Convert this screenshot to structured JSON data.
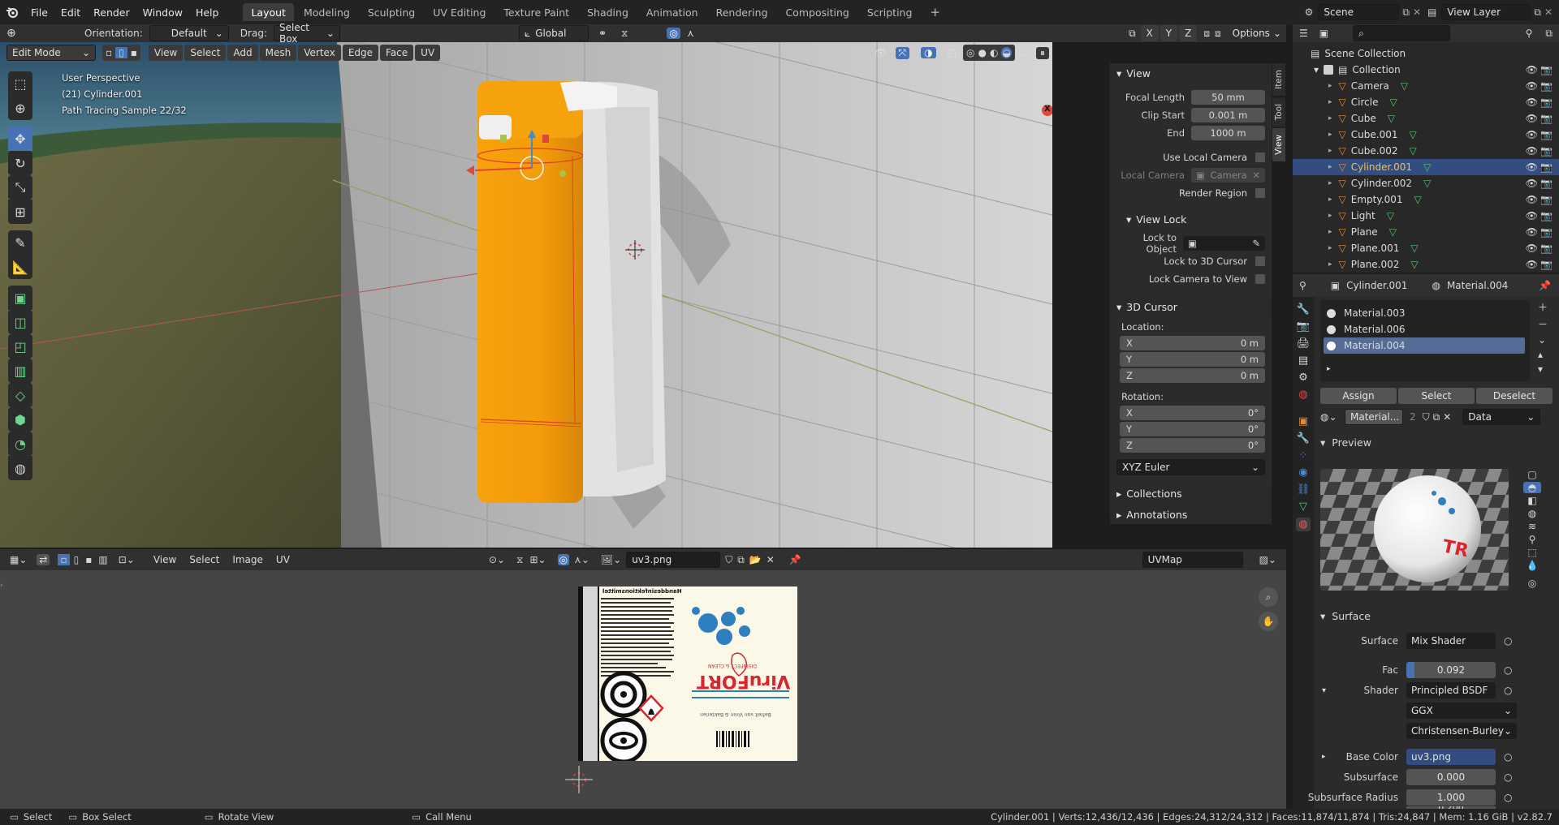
{
  "topbar": {
    "menus": [
      "File",
      "Edit",
      "Render",
      "Window",
      "Help"
    ],
    "workspaces": [
      "Layout",
      "Modeling",
      "Sculpting",
      "UV Editing",
      "Texture Paint",
      "Shading",
      "Animation",
      "Rendering",
      "Compositing",
      "Scripting"
    ],
    "active_workspace": "Layout",
    "add_tab": "+",
    "scene": "Scene",
    "view_layer": "View Layer"
  },
  "tool_header": {
    "orientation_label": "Orientation:",
    "orientation_value": "Default",
    "drag_label": "Drag:",
    "drag_value": "Select Box",
    "transform_orientation": "Global",
    "axes": [
      "X",
      "Y",
      "Z"
    ],
    "options": "Options"
  },
  "viewport_header": {
    "mode": "Edit Mode",
    "menus": [
      "View",
      "Select",
      "Add",
      "Mesh",
      "Vertex",
      "Edge",
      "Face",
      "UV"
    ]
  },
  "viewport_overlay": {
    "perspective": "User Perspective",
    "object": "(21) Cylinder.001",
    "sample": "Path Tracing Sample 22/32"
  },
  "gizmo": {
    "x": "X",
    "y": "Y",
    "z": "Z"
  },
  "npanel": {
    "tabs": [
      "Item",
      "Tool",
      "View"
    ],
    "view_section": "View",
    "focal_length_label": "Focal Length",
    "focal_length": "50 mm",
    "clip_start_label": "Clip Start",
    "clip_start": "0.001 m",
    "end_label": "End",
    "end": "1000 m",
    "use_local_camera": "Use Local Camera",
    "local_camera_label": "Local Camera",
    "local_camera_value": "Camera",
    "render_region": "Render Region",
    "view_lock": "View Lock",
    "lock_to_object": "Lock to Object",
    "lock_to_3d_cursor": "Lock to 3D Cursor",
    "lock_camera_to_view": "Lock Camera to View",
    "cursor_section": "3D Cursor",
    "location_label": "Location:",
    "location": [
      {
        "axis": "X",
        "value": "0 m"
      },
      {
        "axis": "Y",
        "value": "0 m"
      },
      {
        "axis": "Z",
        "value": "0 m"
      }
    ],
    "rotation_label": "Rotation:",
    "rotation": [
      {
        "axis": "X",
        "value": "0°"
      },
      {
        "axis": "Y",
        "value": "0°"
      },
      {
        "axis": "Z",
        "value": "0°"
      }
    ],
    "rotation_mode": "XYZ Euler",
    "collections": "Collections",
    "annotations": "Annotations"
  },
  "outliner": {
    "root": "Scene Collection",
    "collection": "Collection",
    "items": [
      {
        "name": "Camera",
        "color": "#e58a3a"
      },
      {
        "name": "Circle",
        "color": "#e58a3a"
      },
      {
        "name": "Cube",
        "color": "#e58a3a"
      },
      {
        "name": "Cube.001",
        "color": "#e58a3a"
      },
      {
        "name": "Cube.002",
        "color": "#e58a3a"
      },
      {
        "name": "Cylinder.001",
        "color": "#e58a3a",
        "selected": true
      },
      {
        "name": "Cylinder.002",
        "color": "#e58a3a"
      },
      {
        "name": "Empty.001",
        "color": "#e58a3a"
      },
      {
        "name": "Light",
        "color": "#e58a3a"
      },
      {
        "name": "Plane",
        "color": "#e58a3a"
      },
      {
        "name": "Plane.001",
        "color": "#e58a3a"
      },
      {
        "name": "Plane.002",
        "color": "#e58a3a"
      }
    ]
  },
  "properties": {
    "object": "Cylinder.001",
    "material": "Material.004",
    "slots": [
      "Material.003",
      "Material.006",
      "Material.004"
    ],
    "active_slot": "Material.004",
    "assign": "Assign",
    "select": "Select",
    "deselect": "Deselect",
    "material_field": "Material...",
    "users": "2",
    "link": "Data",
    "preview": "Preview",
    "preview_text": "TR",
    "surface_section": "Surface",
    "surface_label": "Surface",
    "surface_value": "Mix Shader",
    "fac_label": "Fac",
    "fac_value": "0.092",
    "fac": 0.092,
    "shader_label": "Shader",
    "shader_value": "Principled BSDF",
    "distribution": "GGX",
    "subsurface_method": "Christensen-Burley",
    "base_color_label": "Base Color",
    "base_color_value": "uv3.png",
    "subsurface_label": "Subsurface",
    "subsurface_value": "0.000",
    "subsurface_radius_label": "Subsurface Radius",
    "subsurface_radius_1": "1.000",
    "subsurface_radius_2": "0.200"
  },
  "uv_editor": {
    "menus": [
      "View",
      "Select",
      "Image",
      "UV"
    ],
    "image": "uv3.png",
    "uvmap": "UVMap",
    "label_heading": "Handdesinfektionsmittel",
    "brand": "ViruFORT",
    "brand_sub": "DISINFECT & CLEAN",
    "tagline": "Befreit von Viren & Bakterien"
  },
  "statusbar": {
    "select": "Select",
    "box_select": "Box Select",
    "rotate_view": "Rotate View",
    "call_menu": "Call Menu",
    "stats": "Cylinder.001 | Verts:12,436/12,436 | Edges:24,312/24,312 | Faces:11,874/11,874 | Tris:24,847 | Mem: 1.16 GiB | v2.82.7"
  },
  "colors": {
    "accent": "#4772b3",
    "selected_row": "#334d80",
    "orange_object": "#f59c0a",
    "label_red": "#d8262f",
    "virus_blue": "#2e7fc0"
  }
}
